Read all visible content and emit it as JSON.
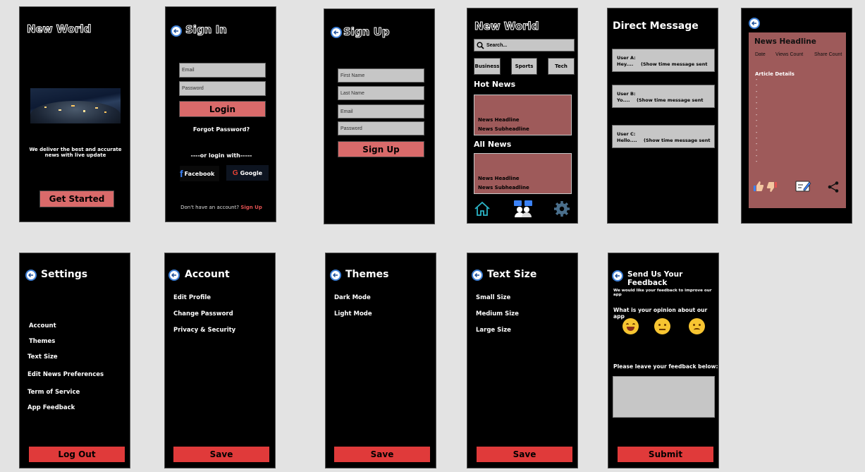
{
  "welcome": {
    "title": "New World",
    "tagline": "We deliver the best and accurate news with live update",
    "cta": "Get Started"
  },
  "signin": {
    "title": "Sign In",
    "email_placeholder": "Email",
    "password_placeholder": "Password",
    "login": "Login",
    "forgot": "Forgot Password?",
    "or_login": "----or login with-----",
    "facebook": "Facebook",
    "google": "Google",
    "no_account": "Don't have an account?",
    "signup_link": "Sign Up"
  },
  "signup": {
    "title": "Sign Up",
    "first_name": "First Name",
    "last_name": "Last Name",
    "email": "Email",
    "password": "Password",
    "button": "Sign Up"
  },
  "home": {
    "title": "New World",
    "search_placeholder": "Search...",
    "categories": [
      "Business",
      "Sports",
      "Tech"
    ],
    "hot_news": "Hot News",
    "all_news": "All News",
    "headline": "News Headline",
    "subheadline": "News Subheadline"
  },
  "dm": {
    "title": "Direct Message",
    "messages": [
      {
        "user": "User A:",
        "text": "Hey....",
        "time": "(Show time message sent"
      },
      {
        "user": "User B:",
        "text": "Yo....",
        "time": "(Show time message sent"
      },
      {
        "user": "User C:",
        "text": "Hello....",
        "time": "(Show time message sent"
      }
    ]
  },
  "article": {
    "headline": "News Headline",
    "date": "Date",
    "views": "Views Count",
    "shares": "Share Count",
    "details": "Article Details",
    "bullets": [
      "-",
      "-",
      "-",
      "-",
      "-",
      "-",
      "-",
      "-",
      "-",
      "-",
      "-",
      "-",
      "-",
      "-",
      "-"
    ]
  },
  "settings": {
    "title": "Settings",
    "items": [
      "Account",
      "Themes",
      "Text Size",
      "Edit News Preferences",
      "Term of Service",
      "App Feedback"
    ],
    "logout": "Log Out"
  },
  "account": {
    "title": "Account",
    "items": [
      "Edit Profile",
      "Change Password",
      "Privacy & Security"
    ],
    "save": "Save"
  },
  "themes": {
    "title": "Themes",
    "items": [
      "Dark Mode",
      "Light Mode"
    ],
    "save": "Save"
  },
  "textsize": {
    "title": "Text Size",
    "items": [
      "Small Size",
      "Medium Size",
      "Large Size"
    ],
    "save": "Save"
  },
  "feedback": {
    "title": "Send Us Your Feedback",
    "intro": "We would like your feedback to improve our app",
    "question": "What is your opinion about our app",
    "leave": "Please leave your feedback below:",
    "submit": "Submit"
  }
}
